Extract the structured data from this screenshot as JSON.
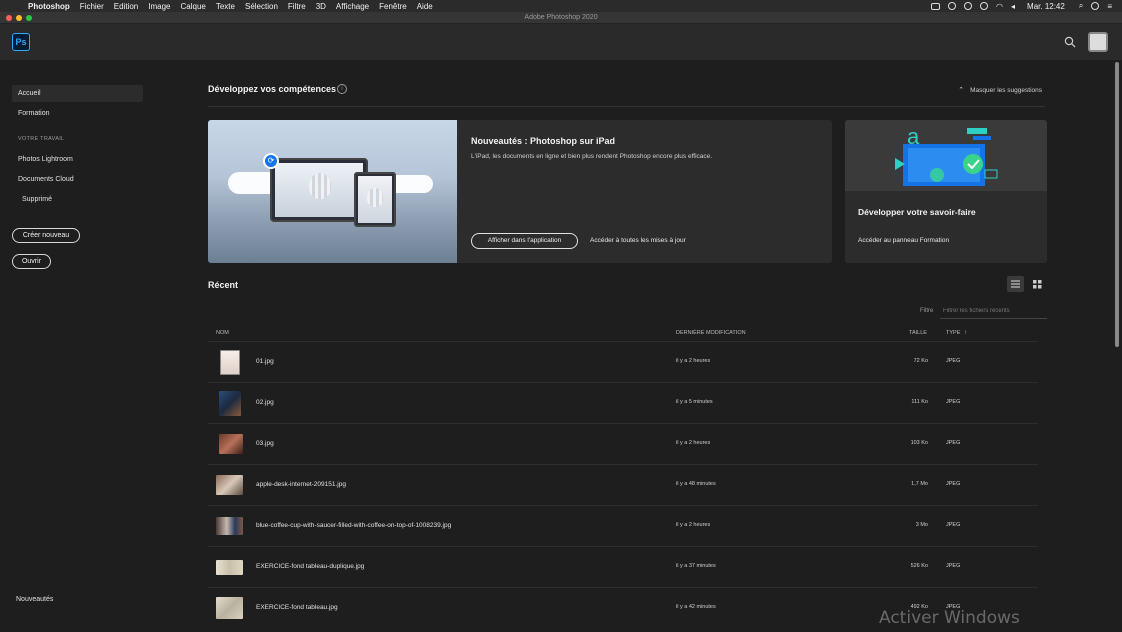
{
  "menubar": {
    "app": "Photoshop",
    "items": [
      "Fichier",
      "Edition",
      "Image",
      "Calque",
      "Texte",
      "Sélection",
      "Filtre",
      "3D",
      "Affichage",
      "Fenêtre",
      "Aide"
    ],
    "clock": "Mar. 12:42"
  },
  "window": {
    "title": "Adobe Photoshop 2020"
  },
  "header": {
    "logo": "Ps"
  },
  "sidebar": {
    "home": "Accueil",
    "learn": "Formation",
    "section": "VOTRE TRAVAIL",
    "lightroom": "Photos Lightroom",
    "cloud_docs": "Documents Cloud",
    "deleted": "Supprimé",
    "create_new": "Créer nouveau",
    "open": "Ouvrir",
    "whats_new": "Nouveautés"
  },
  "suggestions": {
    "title": "Développez vos compétences",
    "hide": "Masquer les suggestions",
    "card1": {
      "title": "Nouveautés : Photoshop sur iPad",
      "desc": "L'iPad, les documents en ligne et bien plus rendent Photoshop encore plus efficace.",
      "button": "Afficher dans l'application",
      "link": "Accéder à toutes les mises à jour"
    },
    "card2": {
      "title": "Développer votre savoir-faire",
      "link": "Accéder au panneau Formation"
    }
  },
  "recent": {
    "title": "Récent",
    "filter_label": "Filtre",
    "filter_placeholder": "Filtrer les fichiers récents",
    "columns": {
      "name": "NOM",
      "modified": "DERNIÈRE MODIFICATION",
      "size": "TAILLE",
      "type": "TYPE"
    },
    "sort_indicator": "↑",
    "rows": [
      {
        "name": "01.jpg",
        "modified": "il y a 2 heures",
        "size": "72 Ko",
        "type": "JPEG"
      },
      {
        "name": "02.jpg",
        "modified": "il y a 5 minutes",
        "size": "111 Ko",
        "type": "JPEG"
      },
      {
        "name": "03.jpg",
        "modified": "il y a 2 heures",
        "size": "103 Ko",
        "type": "JPEG"
      },
      {
        "name": "apple-desk-internet-209151.jpg",
        "modified": "il y a 48 minutes",
        "size": "1,7 Mo",
        "type": "JPEG"
      },
      {
        "name": "blue-coffee-cup-with-saucer-filled-with-coffee-on-top-of-1008239.jpg",
        "modified": "il y a 2 heures",
        "size": "3 Mo",
        "type": "JPEG"
      },
      {
        "name": "EXERCICE-fond tableau-duplique.jpg",
        "modified": "il y a 37 minutes",
        "size": "526 Ko",
        "type": "JPEG"
      },
      {
        "name": "EXERCICE-fond tableau.jpg",
        "modified": "il y a 42 minutes",
        "size": "492 Ko",
        "type": "JPEG"
      }
    ]
  },
  "watermark": "Activer Windows",
  "colors": {
    "accent": "#31a8ff",
    "bg": "#1e1e1e",
    "card": "#2c2c2c"
  }
}
